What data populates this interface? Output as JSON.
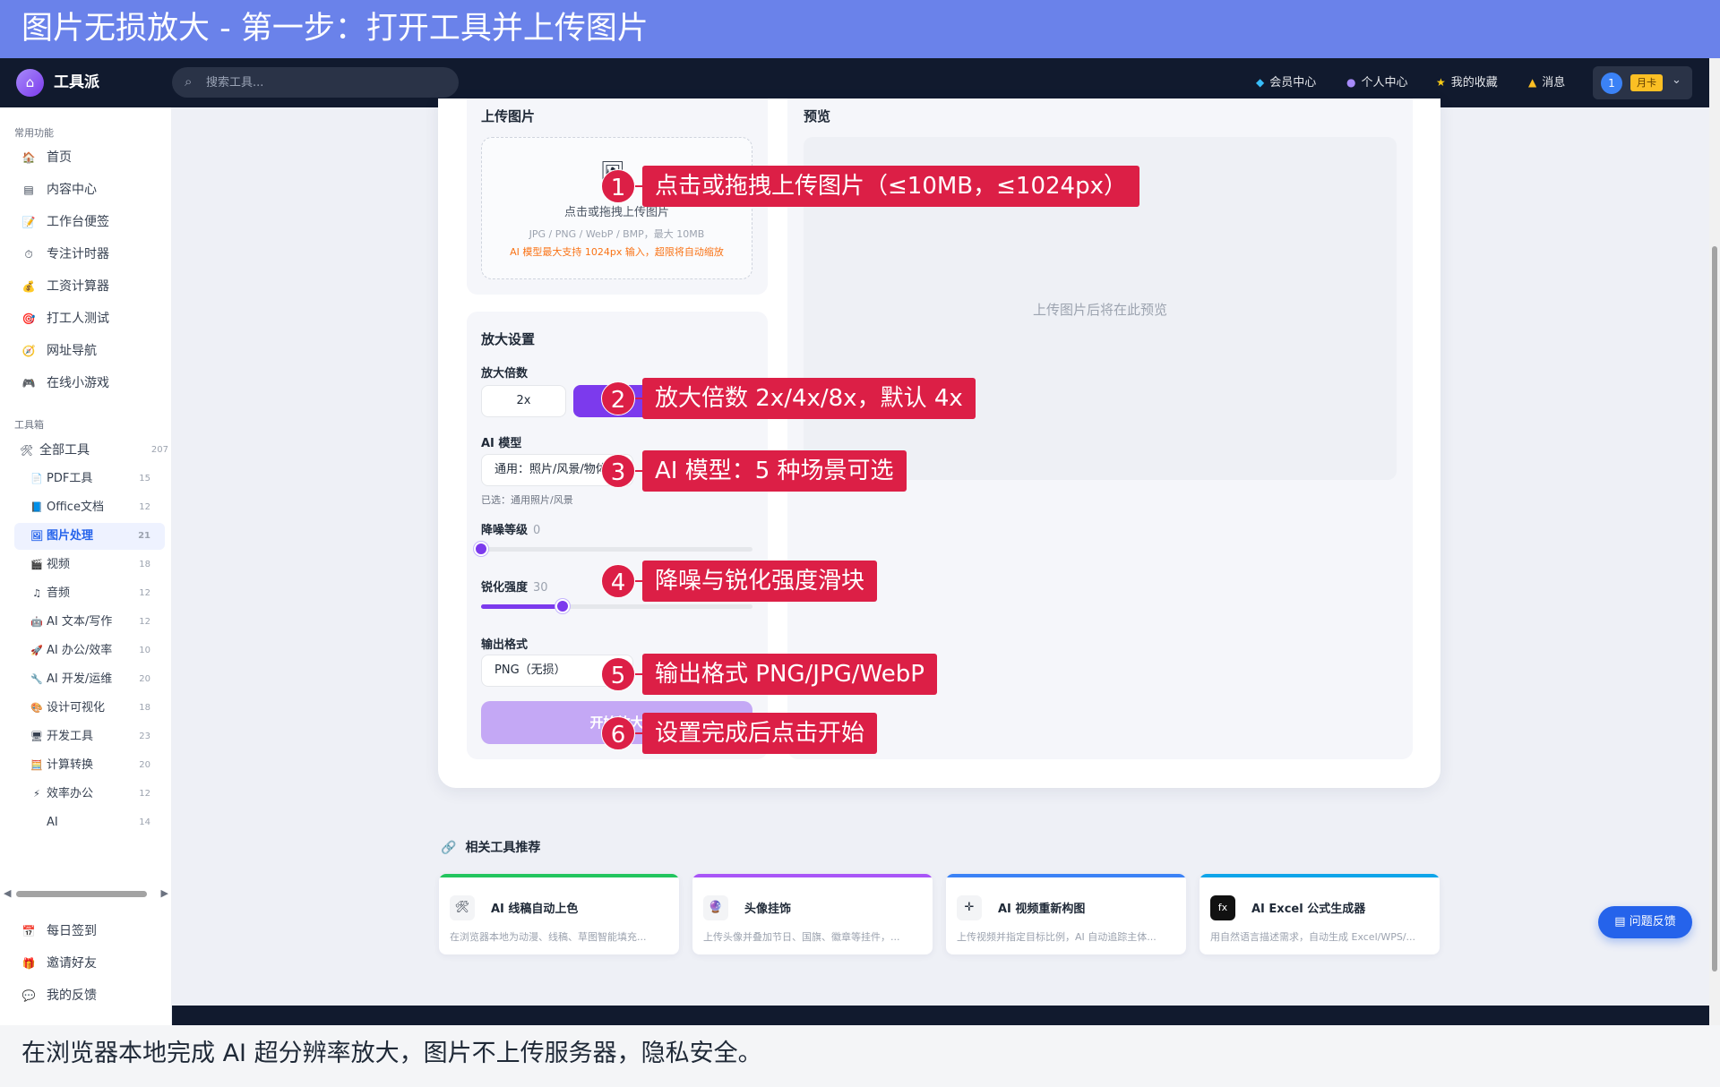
{
  "banner": {
    "title": "图片无损放大 - 第一步：打开工具并上传图片"
  },
  "nav": {
    "brand": "工具派",
    "search_placeholder": "搜索工具...",
    "links": [
      "会员中心",
      "个人中心",
      "我的收藏",
      "消息"
    ],
    "user_avatar": "1",
    "user_badge": "月卡"
  },
  "sidebar": {
    "common_title": "常用功能",
    "common_items": [
      "首页",
      "内容中心",
      "工作台便签",
      "专注计时器",
      "工资计算器",
      "打工人测试",
      "网址导航",
      "在线小游戏"
    ],
    "toolbox_title": "工具箱",
    "all_tools": {
      "label": "全部工具",
      "count": "207"
    },
    "tools": [
      {
        "label": "PDF工具",
        "count": "15"
      },
      {
        "label": "Office文档",
        "count": "12"
      },
      {
        "label": "图片处理",
        "count": "21"
      },
      {
        "label": "视频",
        "count": "18"
      },
      {
        "label": "音频",
        "count": "12"
      },
      {
        "label": "AI 文本/写作",
        "count": "12"
      },
      {
        "label": "AI 办公/效率",
        "count": "10"
      },
      {
        "label": "AI 开发/运维",
        "count": "20"
      },
      {
        "label": "设计可视化",
        "count": "18"
      },
      {
        "label": "开发工具",
        "count": "23"
      },
      {
        "label": "计算转换",
        "count": "20"
      },
      {
        "label": "效率办公",
        "count": "12"
      },
      {
        "label": "AI",
        "count": "14"
      }
    ],
    "bottom_items": [
      "每日签到",
      "邀请好友",
      "我的反馈"
    ]
  },
  "upload": {
    "title": "上传图片",
    "main": "点击或拖拽上传图片",
    "formats": "JPG / PNG / WebP / BMP，最大 10MB",
    "warning": "AI 模型最大支持 1024px 输入，超限将自动缩放"
  },
  "preview": {
    "title": "预览",
    "placeholder": "上传图片后将在此预览"
  },
  "settings": {
    "title": "放大设置",
    "scale_label": "放大倍数",
    "scale_options": [
      "2x",
      "4x"
    ],
    "scale_selected": "4x",
    "model_label": "AI 模型",
    "model_value": "通用：照片/风景/物体",
    "model_hint": "已选：通用照片/风景",
    "denoise_label": "降噪等级",
    "denoise_value": "0",
    "denoise_max": 100,
    "sharpen_label": "锐化强度",
    "sharpen_value": "30",
    "sharpen_max": 100,
    "format_label": "输出格式",
    "format_value": "PNG（无损）",
    "start_button": "开始放大"
  },
  "annotations": [
    {
      "num": "1",
      "text": "点击或拖拽上传图片（≤10MB，≤1024px）"
    },
    {
      "num": "2",
      "text": "放大倍数 2x/4x/8x，默认 4x"
    },
    {
      "num": "3",
      "text": "AI 模型：5 种场景可选"
    },
    {
      "num": "4",
      "text": "降噪与锐化强度滑块"
    },
    {
      "num": "5",
      "text": "输出格式 PNG/JPG/WebP"
    },
    {
      "num": "6",
      "text": "设置完成后点击开始"
    }
  ],
  "related": {
    "title": "相关工具推荐",
    "cards": [
      {
        "name": "AI 线稿自动上色",
        "desc": "在浏览器本地为动漫、线稿、草图智能填充...",
        "color": "#22c55e"
      },
      {
        "name": "头像挂饰",
        "desc": "上传头像并叠加节日、国旗、徽章等挂件，...",
        "color": "#a855f7"
      },
      {
        "name": "AI 视频重新构图",
        "desc": "上传视频并指定目标比例，AI 自动追踪主体...",
        "color": "#3b82f6"
      },
      {
        "name": "AI Excel 公式生成器",
        "desc": "用自然语言描述需求，自动生成 Excel/WPS/...",
        "color": "#0ea5e9"
      }
    ]
  },
  "feedback_button": "问题反馈",
  "caption": "在浏览器本地完成 AI 超分辨率放大，图片不上传服务器，隐私安全。"
}
